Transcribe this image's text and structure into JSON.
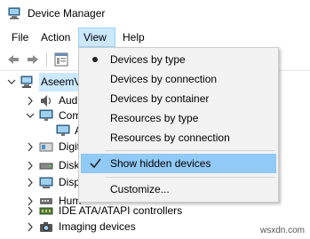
{
  "window": {
    "title": "Device Manager"
  },
  "menu": {
    "file": "File",
    "action": "Action",
    "view": "View",
    "help": "Help"
  },
  "view_menu": {
    "items": [
      {
        "label": "Devices by type",
        "mark": "radio"
      },
      {
        "label": "Devices by connection",
        "mark": "none"
      },
      {
        "label": "Devices by container",
        "mark": "none"
      },
      {
        "label": "Resources by type",
        "mark": "none"
      },
      {
        "label": "Resources by connection",
        "mark": "none"
      },
      {
        "label": "Show hidden devices",
        "mark": "check"
      },
      {
        "label": "Customize...",
        "mark": "none"
      }
    ]
  },
  "tree": {
    "root": "AseemV",
    "items": [
      {
        "label": "Aud"
      },
      {
        "label": "Com"
      },
      {
        "label": "A"
      },
      {
        "label": "Digit"
      },
      {
        "label": "Disk"
      },
      {
        "label": "Disp"
      },
      {
        "label": "Hum"
      },
      {
        "label": "IDE ATA/ATAPI controllers"
      },
      {
        "label": "Imaging devices"
      }
    ]
  },
  "watermark": "wsxdn.com",
  "colors": {
    "menu_highlight": "#91c9f7",
    "menu_bg": "#f2f2f2",
    "active_menu": "#cce8ff",
    "accent": "#0078d7"
  },
  "icons": {
    "app": "device-manager-icon",
    "back": "back-arrow-icon",
    "forward": "forward-arrow-icon",
    "properties": "properties-icon",
    "computer": "computer-icon",
    "audio": "audio-icon",
    "monitor": "monitor-icon",
    "disk": "disk-drive-icon",
    "display": "display-adapter-icon",
    "hid": "hid-icon",
    "ide": "ide-controller-icon",
    "camera": "camera-icon"
  }
}
